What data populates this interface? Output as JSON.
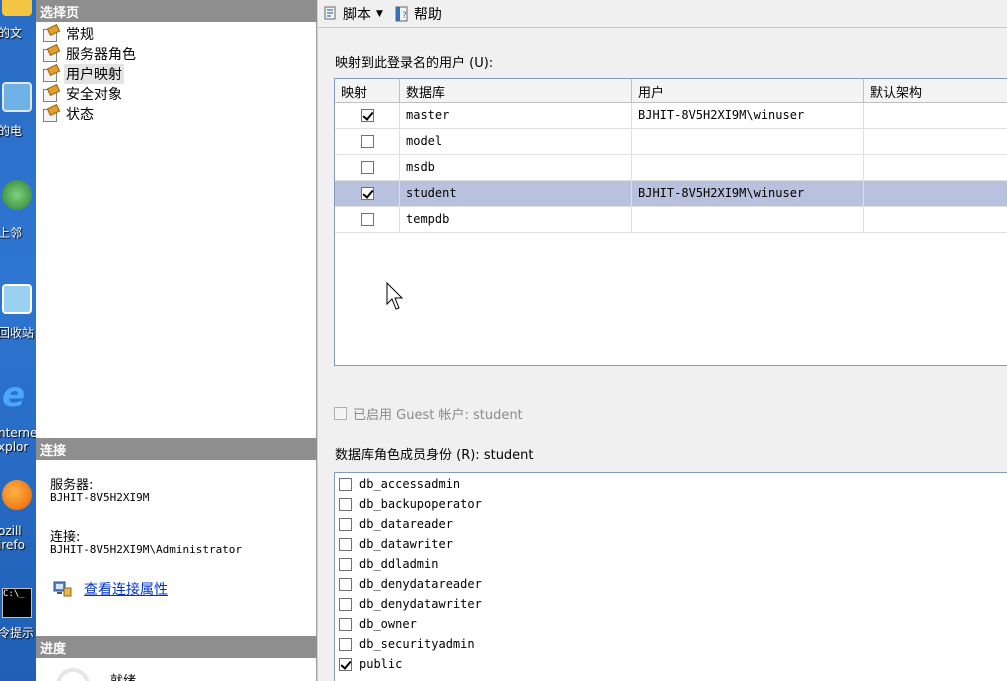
{
  "desktop": {
    "icons": [
      {
        "name": "documents",
        "label": "的文",
        "color": "#f4c542"
      },
      {
        "name": "computer",
        "label": "的电",
        "color": "#6fb2e8"
      },
      {
        "name": "network",
        "label": "上邻",
        "color": "#4caf50"
      },
      {
        "name": "recycle-bin",
        "label": "回收站",
        "color": "#9ad0f0"
      },
      {
        "name": "internet-explorer",
        "label": "nternet\nxplor",
        "color": "#1e88e5"
      },
      {
        "name": "firefox",
        "label": "ozill\nirefo",
        "color": "#e66000"
      },
      {
        "name": "cmd",
        "label": "令提示",
        "color": "#000000"
      }
    ]
  },
  "left": {
    "select_page_header": "选择页",
    "nav_items": [
      {
        "label": "常规"
      },
      {
        "label": "服务器角色"
      },
      {
        "label": "用户映射"
      },
      {
        "label": "安全对象"
      },
      {
        "label": "状态"
      }
    ],
    "selected_index": 2,
    "connection_header": "连接",
    "server_label": "服务器:",
    "server_value": "BJHIT-8V5H2XI9M",
    "connection_label": "连接:",
    "connection_value": "BJHIT-8V5H2XI9M\\Administrator",
    "view_connection_link": "查看连接属性",
    "progress_header": "进度",
    "progress_status": "就绪"
  },
  "toolbar": {
    "script_label": "脚本",
    "help_label": "帮助"
  },
  "mapping": {
    "label": "映射到此登录名的用户 (U):",
    "columns": [
      "映射",
      "数据库",
      "用户",
      "默认架构"
    ],
    "rows": [
      {
        "mapped": true,
        "database": "master",
        "user": "BJHIT-8V5H2XI9M\\winuser",
        "schema": "",
        "selected": false
      },
      {
        "mapped": false,
        "database": "model",
        "user": "",
        "schema": "",
        "selected": false
      },
      {
        "mapped": false,
        "database": "msdb",
        "user": "",
        "schema": "",
        "selected": false
      },
      {
        "mapped": true,
        "database": "student",
        "user": "BJHIT-8V5H2XI9M\\winuser",
        "schema": "",
        "selected": true
      },
      {
        "mapped": false,
        "database": "tempdb",
        "user": "",
        "schema": "",
        "selected": false
      }
    ]
  },
  "guest": {
    "label": "已启用 Guest 帐户: student",
    "checked": false
  },
  "roles": {
    "label": "数据库角色成员身份 (R): student",
    "items": [
      {
        "name": "db_accessadmin",
        "checked": false
      },
      {
        "name": "db_backupoperator",
        "checked": false
      },
      {
        "name": "db_datareader",
        "checked": false
      },
      {
        "name": "db_datawriter",
        "checked": false
      },
      {
        "name": "db_ddladmin",
        "checked": false
      },
      {
        "name": "db_denydatareader",
        "checked": false
      },
      {
        "name": "db_denydatawriter",
        "checked": false
      },
      {
        "name": "db_owner",
        "checked": false
      },
      {
        "name": "db_securityadmin",
        "checked": false
      },
      {
        "name": "public",
        "checked": true
      }
    ]
  }
}
